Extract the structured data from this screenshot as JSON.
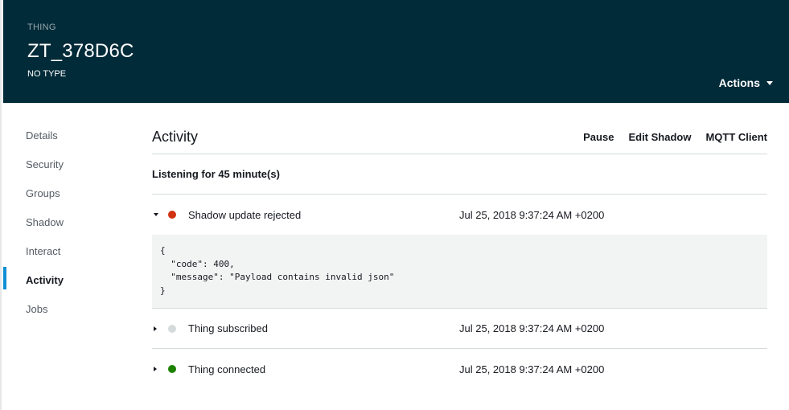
{
  "header": {
    "eyebrow": "THING",
    "title": "ZT_378D6C",
    "subtitle": "NO TYPE",
    "actions_label": "Actions",
    "background_color": "#012b39"
  },
  "sidebar": {
    "items": [
      {
        "label": "Details"
      },
      {
        "label": "Security"
      },
      {
        "label": "Groups"
      },
      {
        "label": "Shadow"
      },
      {
        "label": "Interact"
      },
      {
        "label": "Activity",
        "active": true
      },
      {
        "label": "Jobs"
      }
    ],
    "active_color": "#0f8fd4"
  },
  "main": {
    "title": "Activity",
    "links": {
      "pause": "Pause",
      "edit_shadow": "Edit Shadow",
      "mqtt_client": "MQTT Client"
    },
    "listening": "Listening for 45 minute(s)",
    "events": [
      {
        "label": "Shadow update rejected",
        "time": "Jul 25, 2018 9:37:24 AM +0200",
        "status_color": "#d13212",
        "expanded": true,
        "payload": "{\n  \"code\": 400,\n  \"message\": \"Payload contains invalid json\"\n}"
      },
      {
        "label": "Thing subscribed",
        "time": "Jul 25, 2018 9:37:24 AM +0200",
        "status_color": "#d5dbdb",
        "expanded": false
      },
      {
        "label": "Thing connected",
        "time": "Jul 25, 2018 9:37:24 AM +0200",
        "status_color": "#1d8102",
        "expanded": false
      }
    ]
  }
}
